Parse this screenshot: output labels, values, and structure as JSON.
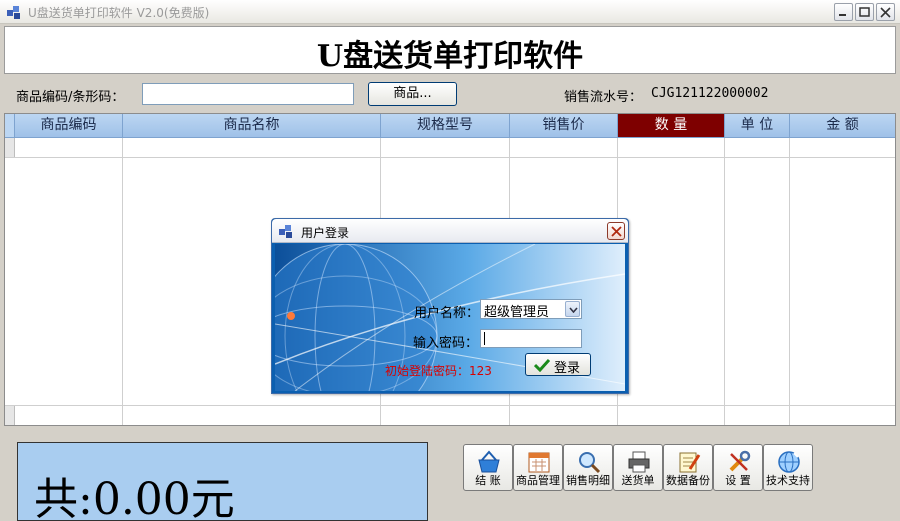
{
  "window": {
    "title": "U盘送货单打印软件 V2.0(免费版)"
  },
  "heading": "U盘送货单打印软件",
  "search": {
    "code_label": "商品编码/条形码：",
    "code_value": "",
    "goods_button": "商品...",
    "serial_label": "销售流水号：",
    "serial_value": "CJG121122000002"
  },
  "table": {
    "columns": [
      "商品编码",
      "商品名称",
      "规格型号",
      "销售价",
      "数 量",
      "单 位",
      "金 额"
    ],
    "selected_column": "数 量"
  },
  "login": {
    "title": "用户登录",
    "username_label": "用户名称：",
    "username_value": "超级管理员",
    "password_label": "输入密码：",
    "password_value": "",
    "hint": "初始登陆密码：123",
    "login_button": "登录"
  },
  "total": {
    "text": "共:0.00元"
  },
  "toolbar": [
    {
      "label": "结 账",
      "icon": "basket-icon"
    },
    {
      "label": "商品管理",
      "icon": "calendar-icon"
    },
    {
      "label": "销售明细",
      "icon": "magnifier-icon"
    },
    {
      "label": "送货单",
      "icon": "printer-icon"
    },
    {
      "label": "数据备份",
      "icon": "backup-icon"
    },
    {
      "label": "设 置",
      "icon": "tools-icon"
    },
    {
      "label": "技术支持",
      "icon": "support-icon"
    }
  ],
  "colors": {
    "header_blue": "#9fc1e8",
    "selected_header": "#7e0000",
    "total_bg": "#a9cdf0",
    "hint_red": "#d80000"
  }
}
